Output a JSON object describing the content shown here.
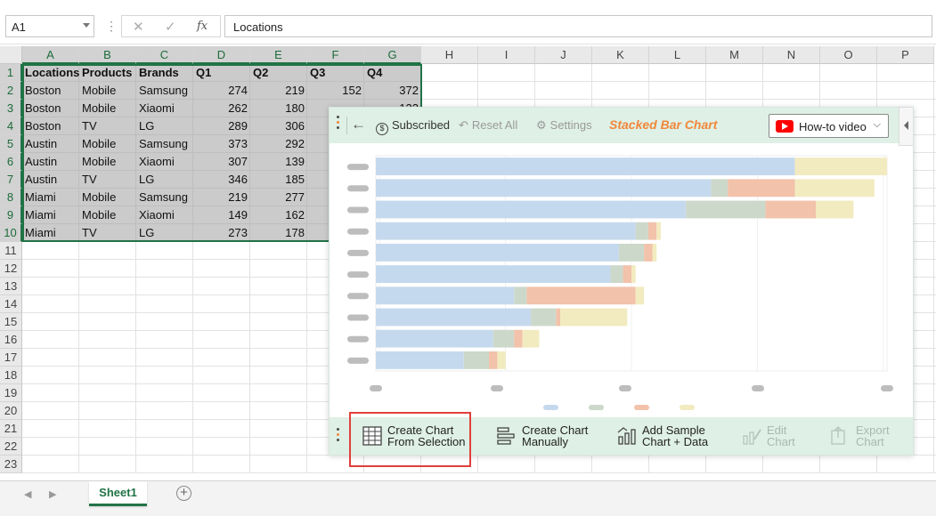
{
  "formula_bar": {
    "name_box": "A1",
    "cancel_glyph": "✕",
    "enter_glyph": "✓",
    "fx_glyph": "fx",
    "formula_value": "Locations"
  },
  "columns": [
    "A",
    "B",
    "C",
    "D",
    "E",
    "F",
    "G",
    "H",
    "I",
    "J",
    "K",
    "L",
    "M",
    "N",
    "O",
    "P"
  ],
  "selected_columns": [
    "A",
    "B",
    "C",
    "D",
    "E",
    "F",
    "G"
  ],
  "rows": [
    "1",
    "2",
    "3",
    "4",
    "5",
    "6",
    "7",
    "8",
    "9",
    "10",
    "11",
    "12",
    "13",
    "14",
    "15",
    "16",
    "17",
    "18",
    "19",
    "20",
    "21",
    "22",
    "23"
  ],
  "selected_rows": [
    "1",
    "2",
    "3",
    "4",
    "5",
    "6",
    "7",
    "8",
    "9",
    "10"
  ],
  "table": {
    "headers": [
      "Locations",
      "Products",
      "Brands",
      "Q1",
      "Q2",
      "Q3",
      "Q4"
    ],
    "rows": [
      [
        "Boston",
        "Mobile",
        "Samsung",
        "274",
        "219",
        "152",
        "372"
      ],
      [
        "Boston",
        "Mobile",
        "Xiaomi",
        "262",
        "180",
        "",
        ""
      ],
      [
        "Boston",
        "TV",
        "LG",
        "289",
        "306",
        "",
        ""
      ],
      [
        "Austin",
        "Mobile",
        "Samsung",
        "373",
        "292",
        "",
        ""
      ],
      [
        "Austin",
        "Mobile",
        "Xiaomi",
        "307",
        "139",
        "",
        ""
      ],
      [
        "Austin",
        "TV",
        "LG",
        "346",
        "185",
        "",
        ""
      ],
      [
        "Miami",
        "Mobile",
        "Samsung",
        "219",
        "277",
        "",
        ""
      ],
      [
        "Miami",
        "Mobile",
        "Xiaomi",
        "149",
        "162",
        "",
        ""
      ],
      [
        "Miami",
        "TV",
        "LG",
        "273",
        "178",
        "",
        ""
      ]
    ],
    "partial_q4_row3": "122"
  },
  "sheet_tabs": {
    "prev_glyph": "◀",
    "next_glyph": "▶",
    "active_tab": "Sheet1",
    "add_glyph": "+"
  },
  "panel": {
    "back_glyph": "←",
    "subscribed_label": "Subscribed",
    "subscribed_icon": "dollar-coin-icon",
    "reset_label": "Reset All",
    "reset_glyph": "↶",
    "settings_label": "Settings",
    "settings_glyph": "⚙",
    "chart_title": "Stacked Bar Chart",
    "howto_label": "How-to video",
    "howto_chev": "⌵",
    "bottom_buttons": [
      {
        "line1": "Create Chart",
        "line2": "From Selection"
      },
      {
        "line1": "Create Chart",
        "line2": "Manually"
      },
      {
        "line1": "Add Sample",
        "line2": "Chart + Data"
      },
      {
        "line1": "Edit",
        "line2": "Chart"
      },
      {
        "line1": "Export",
        "line2": "Chart"
      }
    ],
    "colors": {
      "panel_bg": "#dff0e6",
      "title": "#f0873a",
      "highlight": "#e0403a",
      "grip_top": [
        "#4a4a4a",
        "#f0873a",
        "#4a4a4a"
      ]
    }
  },
  "chart_data": {
    "type": "bar",
    "orientation": "horizontal",
    "stacked": true,
    "placeholder": true,
    "series_colors": [
      "#c5d9ee",
      "#ccd8ca",
      "#f2c2aa",
      "#f2ebc0"
    ],
    "series": [
      {
        "values": [
          100,
          80,
          74,
          62,
          58,
          56,
          33,
          37,
          28,
          21
        ]
      },
      {
        "values": [
          0,
          4,
          19,
          3,
          6,
          3,
          3,
          6,
          5,
          6
        ]
      },
      {
        "values": [
          0,
          16,
          12,
          2,
          2,
          2,
          26,
          1,
          2,
          2
        ]
      },
      {
        "values": [
          22,
          19,
          9,
          1,
          1,
          1,
          2,
          16,
          4,
          2
        ]
      }
    ],
    "xlim": [
      0,
      140
    ]
  }
}
